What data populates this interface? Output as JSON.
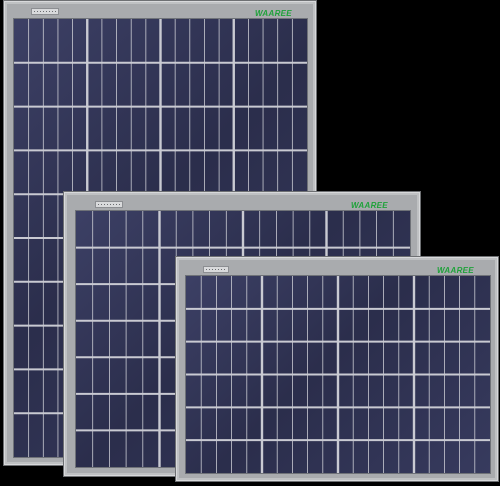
{
  "scene": {
    "subject": "three solar panels",
    "background_color": "#000000",
    "frame_color": "#a9abae",
    "cell_color": "#2e3150",
    "grid_line_color": "#c9cad2",
    "brand_color": "#1fa23a"
  },
  "panels": [
    {
      "name": "large",
      "brand": "WAAREE",
      "cell_columns": 20,
      "cell_rows": 10,
      "string_columns": 4
    },
    {
      "name": "medium",
      "brand": "WAAREE",
      "cell_columns": 20,
      "cell_rows": 7,
      "string_columns": 4
    },
    {
      "name": "small",
      "brand": "WAAREE",
      "cell_columns": 20,
      "cell_rows": 6,
      "string_columns": 4
    }
  ]
}
